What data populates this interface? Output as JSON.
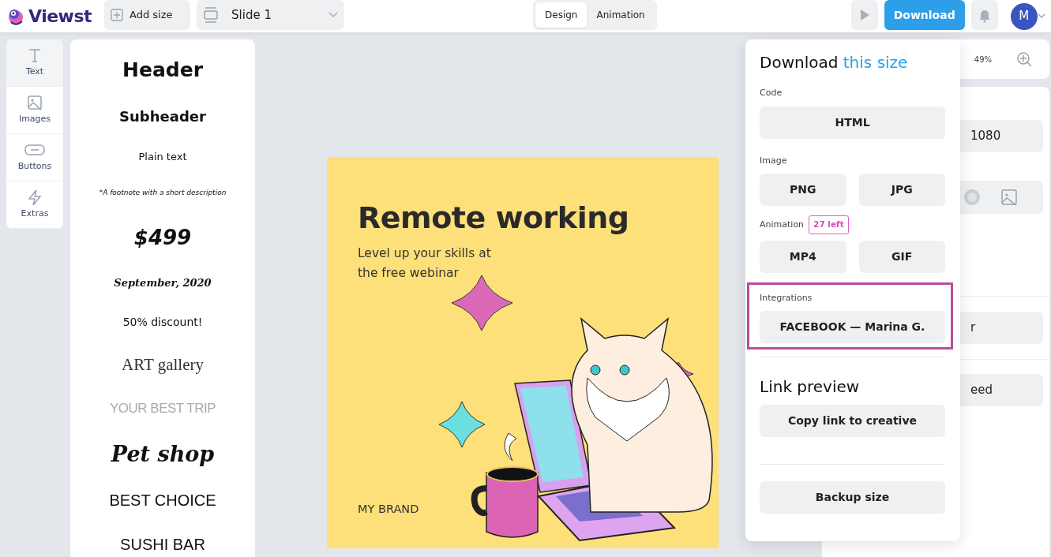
{
  "header": {
    "brand": "Viewst",
    "add_size": "Add size",
    "slide": "Slide 1",
    "download": "Download",
    "avatar": "M"
  },
  "mode_tabs": [
    {
      "label": "Design",
      "selected": true
    },
    {
      "label": "Animation",
      "selected": false
    }
  ],
  "tools": [
    {
      "label": "Text",
      "kind": "text",
      "selected": true
    },
    {
      "label": "Images",
      "kind": "image",
      "selected": false
    },
    {
      "label": "Buttons",
      "kind": "button",
      "selected": false
    },
    {
      "label": "Extras",
      "kind": "bolt",
      "selected": false
    }
  ],
  "text_styles": [
    {
      "text": "Header",
      "kind": "header"
    },
    {
      "text": "Subheader",
      "kind": "subheader"
    },
    {
      "text": "Plain text",
      "kind": "plain"
    },
    {
      "text": "*A footnote with a short description",
      "kind": "footnote"
    },
    {
      "text": "$499",
      "kind": "price"
    },
    {
      "text": "September, 2020",
      "kind": "date"
    },
    {
      "text": "50% discount!",
      "kind": "discount"
    },
    {
      "text": "ART gallery",
      "kind": "art"
    },
    {
      "text": "YOUR BEST TRIP",
      "kind": "trip"
    },
    {
      "text": "Pet shop",
      "kind": "script"
    },
    {
      "text": "BEST CHOICE",
      "kind": "choice"
    },
    {
      "text": "SUSHI BAR",
      "kind": "choice"
    }
  ],
  "artboard": {
    "title": "Remote working",
    "subtitle": [
      "Level up your skills at",
      "the free webinar"
    ],
    "brand": "MY BRAND"
  },
  "right_panel": {
    "zoom": "49%",
    "size_value": "1080",
    "button_1": "r",
    "button_2": "eed"
  },
  "download_menu": {
    "title": "Download",
    "title_accent": "this size",
    "sections": [
      {
        "label": "Code",
        "highlighted": false,
        "buttons": [
          "HTML"
        ]
      },
      {
        "label": "Image",
        "highlighted": false,
        "buttons": [
          "PNG",
          "JPG"
        ]
      },
      {
        "label": "Animation",
        "badge": "27 left",
        "highlighted": false,
        "buttons": [
          "MP4",
          "GIF"
        ]
      },
      {
        "label": "Integrations",
        "highlighted": true,
        "buttons": [
          "FACEBOOK — Marina G."
        ]
      }
    ],
    "link_preview": {
      "title": "Link preview",
      "button": "Copy link to creative"
    },
    "backup": "Backup size"
  }
}
